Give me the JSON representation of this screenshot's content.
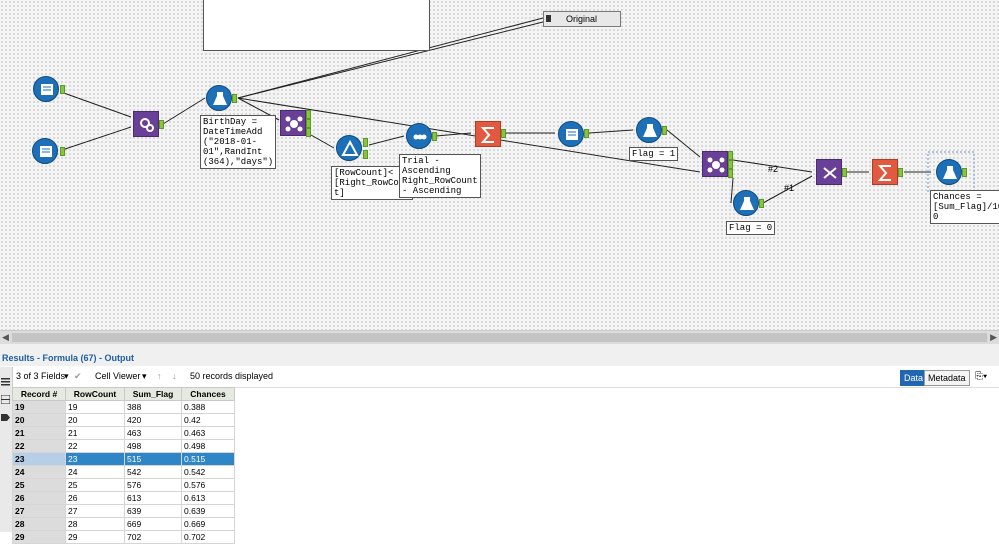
{
  "workflow": {
    "browse_label": "Original",
    "annotations": {
      "formula1": "BirthDay =\nDateTimeAdd\n(\"2018-01-\n01\",RandInt\n(364),\"days\")",
      "filter": "[RowCount]<\n[Right_RowCoun\nt]",
      "sort": "Trial -\nAscending\nRight_RowCount\n- Ascending",
      "formula_flag1": "Flag = 1",
      "formula_flag0": "Flag = 0",
      "formula_chances": "Chances =\n[Sum_Flag]/100\n0"
    },
    "wire_labels": {
      "w2": "#2",
      "w1": "#1"
    },
    "colors": {
      "canvas": "#f4f4f4",
      "tool_blue": "#1d6fb8",
      "tool_purple": "#6a3f97",
      "tool_orange": "#e2593f",
      "anchor_green": "#86c441"
    }
  },
  "results": {
    "title": "Results - Formula (67) - Output",
    "fields_selector": "3 of 3 Fields",
    "cell_viewer": "Cell Viewer",
    "records_displayed": "50 records displayed",
    "tab_data": "Data",
    "tab_metadata": "Metadata",
    "columns": [
      "Record #",
      "RowCount",
      "Sum_Flag",
      "Chances"
    ],
    "rows": [
      [
        "19",
        "19",
        "388",
        "0.388"
      ],
      [
        "20",
        "20",
        "420",
        "0.42"
      ],
      [
        "21",
        "21",
        "463",
        "0.463"
      ],
      [
        "22",
        "22",
        "498",
        "0.498"
      ],
      [
        "23",
        "23",
        "515",
        "0.515"
      ],
      [
        "24",
        "24",
        "542",
        "0.542"
      ],
      [
        "25",
        "25",
        "576",
        "0.576"
      ],
      [
        "26",
        "26",
        "613",
        "0.613"
      ],
      [
        "27",
        "27",
        "639",
        "0.639"
      ],
      [
        "28",
        "28",
        "669",
        "0.669"
      ],
      [
        "29",
        "29",
        "702",
        "0.702"
      ]
    ],
    "selected_row_index": 4
  }
}
